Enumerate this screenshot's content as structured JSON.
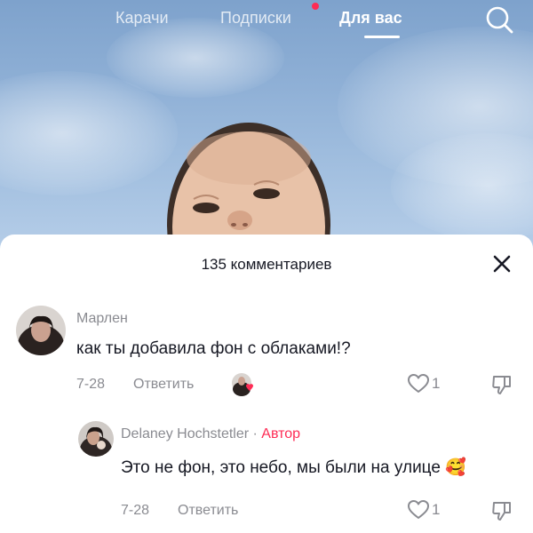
{
  "top_nav": {
    "tabs": [
      {
        "label": "Карачи",
        "active": false
      },
      {
        "label": "Подписки",
        "active": false,
        "has_notification": true
      },
      {
        "label": "Для вас",
        "active": true
      }
    ]
  },
  "comments_sheet": {
    "title": "135 комментариев",
    "comments": [
      {
        "username": "Марлен",
        "text": "как ты добавила фон с облаками!?",
        "date": "7-28",
        "reply_label": "Ответить",
        "likes": "1",
        "liked_by_creator": true
      }
    ],
    "replies": [
      {
        "username": "Delaney Hochstetler",
        "separator": " · ",
        "author_badge": "Автор",
        "text": "Это не фон, это небо, мы были на улице 🥰",
        "date": "7-28",
        "reply_label": "Ответить",
        "likes": "1"
      }
    ]
  },
  "colors": {
    "accent": "#fe2c55",
    "secondary_text": "#8a8b91",
    "primary_text": "#161823"
  },
  "icons": [
    "search-icon",
    "close-icon",
    "heart-outline-icon",
    "thumbs-down-icon",
    "creator-liked-icon"
  ]
}
